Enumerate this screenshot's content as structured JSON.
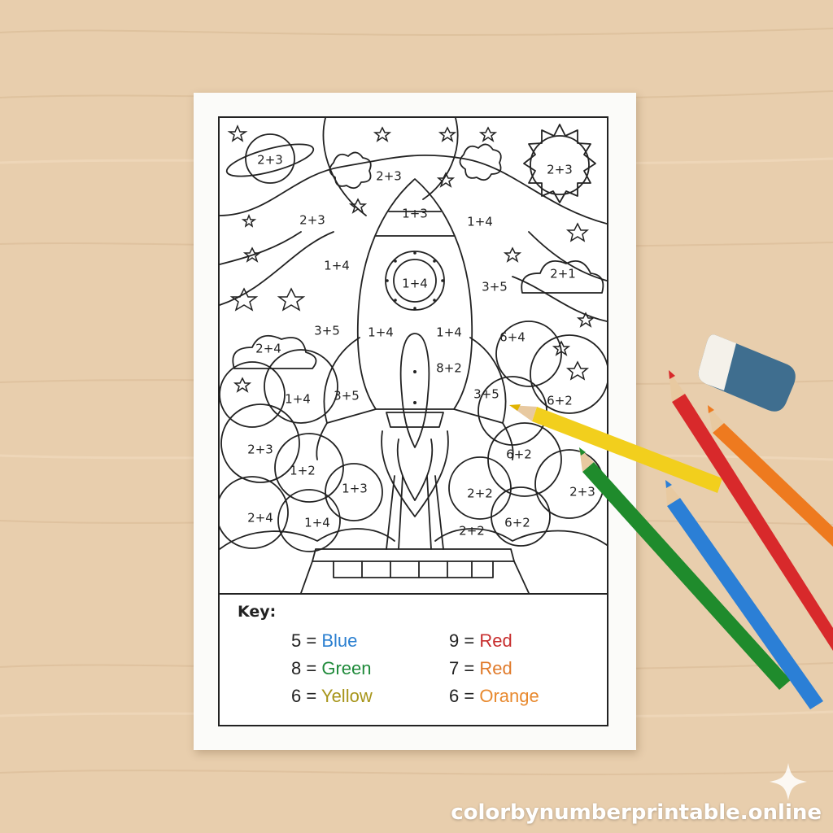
{
  "puzzle_labels": [
    {
      "id": "planet",
      "text": "2+3"
    },
    {
      "id": "top-center",
      "text": "2+3"
    },
    {
      "id": "sun",
      "text": "2+3"
    },
    {
      "id": "left-upper",
      "text": "2+3"
    },
    {
      "id": "nose",
      "text": "1+3"
    },
    {
      "id": "right-upper",
      "text": "1+4"
    },
    {
      "id": "left-mid",
      "text": "1+4"
    },
    {
      "id": "cloud-top-right",
      "text": "2+1"
    },
    {
      "id": "window",
      "text": "1+4"
    },
    {
      "id": "right-mid",
      "text": "3+5"
    },
    {
      "id": "left-mid2",
      "text": "3+5"
    },
    {
      "id": "body-left",
      "text": "1+4"
    },
    {
      "id": "body-right",
      "text": "1+4"
    },
    {
      "id": "right-mid2",
      "text": "6+4"
    },
    {
      "id": "cloud-left",
      "text": "2+4"
    },
    {
      "id": "body-low",
      "text": "8+2"
    },
    {
      "id": "fin-left",
      "text": "3+5"
    },
    {
      "id": "fin-right",
      "text": "3+5"
    },
    {
      "id": "left-low",
      "text": "1+4"
    },
    {
      "id": "right-low",
      "text": "6+2"
    },
    {
      "id": "left-bubble",
      "text": "2+3"
    },
    {
      "id": "right-bubble",
      "text": "6+2"
    },
    {
      "id": "left-bubble2",
      "text": "1+2"
    },
    {
      "id": "center-bubble",
      "text": "1+3"
    },
    {
      "id": "center-right-bubble",
      "text": "2+2"
    },
    {
      "id": "far-right-bubble",
      "text": "2+3"
    },
    {
      "id": "bottom-left",
      "text": "2+4"
    },
    {
      "id": "bottom-left2",
      "text": "1+4"
    },
    {
      "id": "bottom-right",
      "text": "6+2"
    },
    {
      "id": "bottom-center",
      "text": "2+2"
    }
  ],
  "key": {
    "title": "Key:",
    "entries": [
      {
        "num": "5 =",
        "word": "Blue",
        "color": "#2a7fd0"
      },
      {
        "num": "8 =",
        "word": "Green",
        "color": "#1f8a3a"
      },
      {
        "num": "6 =",
        "word": "Yellow",
        "color": "#a7951a"
      },
      {
        "num": "9 =",
        "word": "Red",
        "color": "#c72d2d"
      },
      {
        "num": "7 =",
        "word": "Red",
        "color": "#e07a2a"
      },
      {
        "num": "6 =",
        "word": "Orange",
        "color": "#e8892e"
      }
    ]
  },
  "watermark": "colorbynumberprintable.online",
  "icons": [
    "sparkle-icon"
  ],
  "colors": {
    "table": "#e9cfae",
    "pencil_yellow": "#f2cf1d",
    "pencil_green": "#1f8b2c",
    "pencil_blue": "#2b7fd6",
    "pencil_red": "#d8292b",
    "pencil_orange": "#ee7a1f",
    "eraser_blue": "#3f6e8f"
  }
}
